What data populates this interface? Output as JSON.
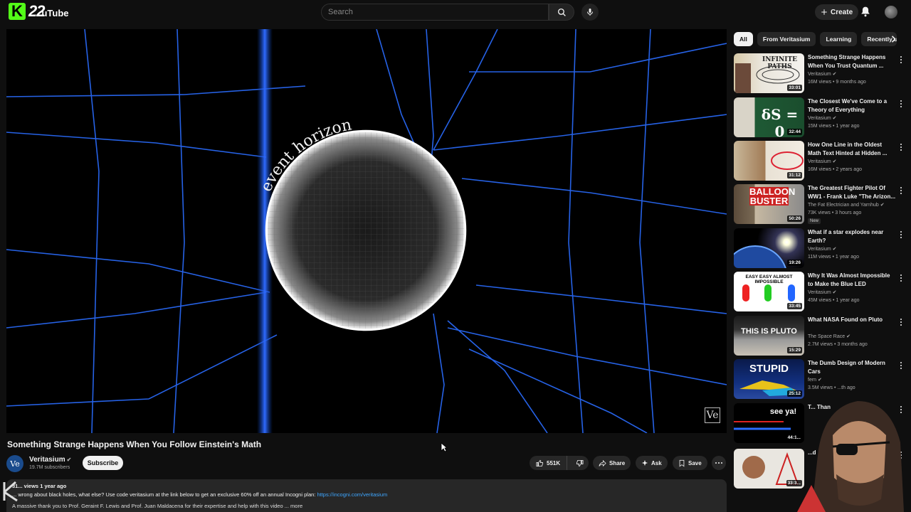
{
  "header": {
    "logo_k": "K",
    "logo_number": "22",
    "logo_text": "uTube",
    "search_placeholder": "Search",
    "create_label": "Create"
  },
  "player": {
    "overlay_text": "event horizon",
    "watermark": "Ve"
  },
  "video": {
    "title": "Something Strange Happens When You Follow Einstein's Math",
    "channel": "Veritasium",
    "channel_avatar_text": "Ve",
    "subscribers": "19.7M subscribers",
    "subscribe_label": "Subscribe",
    "likes": "551K",
    "share_label": "Share",
    "ask_label": "Ask",
    "save_label": "Save"
  },
  "description": {
    "meta": "31... views  1 year ago",
    "line1": "... wrong about black holes, what else? Use code veritasium at the link below to get an exclusive 60% off an annual Incogni plan: ",
    "link": "https://incogni.com/veritasium",
    "line2": "A massive thank you to Prof. Geraint F. Lewis and Prof. Juan Maldacena for their expertise and help with this video ... more"
  },
  "chips": [
    "All",
    "From Veritasium",
    "Learning",
    "Recently u"
  ],
  "recommendations": [
    {
      "title": "Something Strange Happens When You Trust Quantum ...",
      "channel": "Veritasium",
      "verified": true,
      "stats": "16M views • 9 months ago",
      "duration": "33:01",
      "thumb_text": "INFINITE PATHS"
    },
    {
      "title": "The Closest We've Come to a Theory of Everything",
      "channel": "Veritasium",
      "verified": true,
      "stats": "15M views • 1 year ago",
      "duration": "32:44",
      "thumb_text": "δS = 0"
    },
    {
      "title": "How One Line in the Oldest Math Text Hinted at Hidden ...",
      "channel": "Veritasium",
      "verified": true,
      "stats": "16M views • 2 years ago",
      "duration": "31:12",
      "thumb_text": ""
    },
    {
      "title": "The Greatest Fighter Pilot Of WW1 - Frank Luke \"The Arizon...",
      "channel": "The Fat Electrician and Yarnhub",
      "verified": true,
      "stats": "73K views • 3 hours ago",
      "duration": "50:26",
      "thumb_text": "BALLOON BUSTER",
      "badge": "New"
    },
    {
      "title": "What if a star explodes near Earth?",
      "channel": "Veritasium",
      "verified": true,
      "stats": "11M views • 1 year ago",
      "duration": "19:26",
      "thumb_text": ""
    },
    {
      "title": "Why It Was Almost Impossible to Make the Blue LED",
      "channel": "Veritasium",
      "verified": true,
      "stats": "45M views • 1 year ago",
      "duration": "33:45",
      "thumb_text": "EASY  EASY  ALMOST IMPOSSIBLE"
    },
    {
      "title": "What NASA Found on Pluto",
      "channel": "The Space Race",
      "verified": true,
      "stats": "2.7M views • 3 months ago",
      "duration": "15:29",
      "thumb_text": "THIS IS PLUTO"
    },
    {
      "title": "The Dumb Design of Modern Cars",
      "channel": "fern",
      "verified": true,
      "stats": "3.5M views • ...th ago",
      "duration": "25:12",
      "thumb_text": "STUPID"
    },
    {
      "title": "T... Than",
      "channel": "",
      "verified": false,
      "stats": "",
      "duration": "44:1...",
      "thumb_text": "see ya!"
    },
    {
      "title": "...d",
      "channel": "",
      "verified": false,
      "stats": "",
      "duration": "33:3...",
      "thumb_text": ""
    }
  ],
  "colors": {
    "accent_link": "#3ea6ff",
    "kick_green": "#53fc18",
    "background": "#0f0f0f"
  }
}
